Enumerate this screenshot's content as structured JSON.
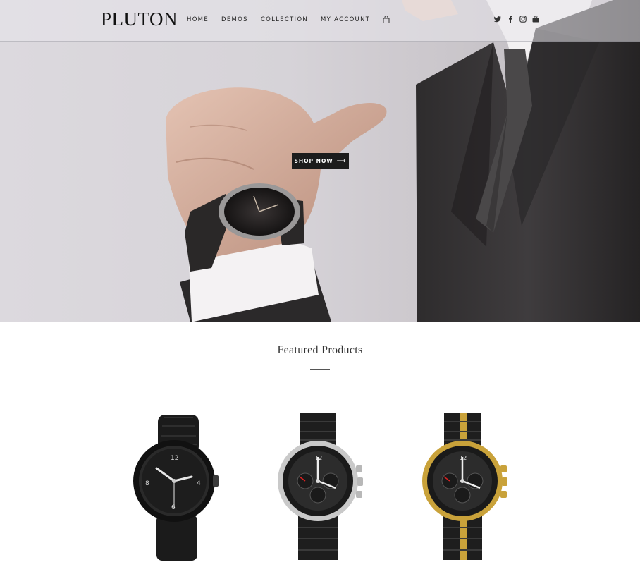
{
  "header": {
    "logo": "PLUTON",
    "nav": [
      "HOME",
      "DEMOS",
      "COLLECTION",
      "MY ACCOUNT"
    ],
    "cart_icon": "shopping-bag-icon",
    "social_icons": [
      "twitter-icon",
      "facebook-icon",
      "instagram-icon",
      "youtube-icon"
    ]
  },
  "hero": {
    "cta_label": "SHOP NOW",
    "cta_arrow": "⟶"
  },
  "featured": {
    "title": "Featured Products",
    "products": [
      {
        "name": "black-leather-strap-watch"
      },
      {
        "name": "silver-chronograph-watch"
      },
      {
        "name": "gold-chronograph-watch"
      }
    ]
  },
  "colors": {
    "accent": "#1c1c1c",
    "hero_bg": "#d6d3d8",
    "gold": "#c9a23a"
  }
}
